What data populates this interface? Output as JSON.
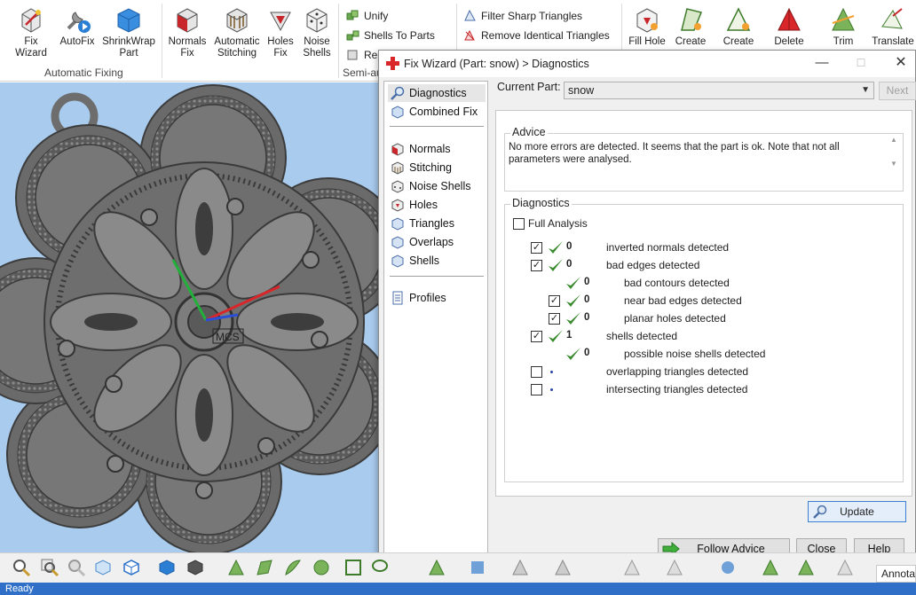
{
  "ribbon": {
    "buttons": [
      {
        "label": "Fix\nWizard",
        "icon": "fix-wizard-icon"
      },
      {
        "label": "AutoFix",
        "icon": "autofix-icon"
      },
      {
        "label": "ShrinkWrap\nPart",
        "icon": "shrinkwrap-icon"
      },
      {
        "label": "Normals\nFix",
        "icon": "normals-fix-icon"
      },
      {
        "label": "Automatic\nStitching",
        "icon": "stitching-icon"
      },
      {
        "label": "Holes\nFix",
        "icon": "holes-fix-icon"
      },
      {
        "label": "Noise\nShells",
        "icon": "noise-shells-icon"
      },
      {
        "label": "Fill Hole",
        "icon": "fill-hole-icon"
      },
      {
        "label": "Create",
        "icon": "create-icon"
      },
      {
        "label": "Create",
        "icon": "create-triangle-icon"
      },
      {
        "label": "Delete",
        "icon": "delete-icon"
      },
      {
        "label": "Trim",
        "icon": "trim-icon"
      },
      {
        "label": "Translate",
        "icon": "translate-icon"
      }
    ],
    "small_items": [
      {
        "label": "Unify",
        "icon": "unify-icon"
      },
      {
        "label": "Shells To Parts",
        "icon": "shells-to-parts-icon"
      },
      {
        "label": "Re",
        "icon": "re-icon"
      },
      {
        "label": "Filter Sharp Triangles",
        "icon": "filter-sharp-icon"
      },
      {
        "label": "Remove Identical Triangles",
        "icon": "remove-identical-icon"
      }
    ],
    "groups": {
      "automatic_fixing": "Automatic Fixing",
      "semi_auto": "Semi-au"
    }
  },
  "viewport": {
    "axis_label": "MCS"
  },
  "dialog": {
    "title": "Fix Wizard (Part: snow) > Diagnostics",
    "controls": {
      "minimize": "—",
      "maximize": "☐",
      "close": "✕"
    },
    "nav": [
      {
        "label": "Diagnostics",
        "icon": "diagnostics-icon",
        "selected": true
      },
      {
        "label": "Combined Fix",
        "icon": "combined-fix-icon"
      },
      {
        "label": "Normals",
        "icon": "normals-icon"
      },
      {
        "label": "Stitching",
        "icon": "stitching-icon"
      },
      {
        "label": "Noise Shells",
        "icon": "noise-shells-icon"
      },
      {
        "label": "Holes",
        "icon": "holes-icon"
      },
      {
        "label": "Triangles",
        "icon": "triangles-icon"
      },
      {
        "label": "Overlaps",
        "icon": "overlaps-icon"
      },
      {
        "label": "Shells",
        "icon": "shells-icon"
      },
      {
        "label": "Profiles",
        "icon": "profiles-icon"
      }
    ],
    "current_part_label": "Current Part:",
    "current_part_value": "snow",
    "next_label": "Next",
    "advice_title": "Advice",
    "advice_text": "No more errors are detected. It seems that the part is ok. Note that not all parameters were analysed.",
    "diagnostics_title": "Diagnostics",
    "full_analysis_label": "Full Analysis",
    "full_analysis_checked": false,
    "rows": [
      {
        "checked": true,
        "status": "ok",
        "count": "0",
        "label": "inverted normals detected",
        "indent": 0
      },
      {
        "checked": true,
        "status": "ok",
        "count": "0",
        "label": "bad edges detected",
        "indent": 0
      },
      {
        "checked": null,
        "status": "ok",
        "count": "0",
        "label": "bad contours detected",
        "indent": 1
      },
      {
        "checked": true,
        "status": "ok",
        "count": "0",
        "label": "near bad edges detected",
        "indent": 1
      },
      {
        "checked": true,
        "status": "ok",
        "count": "0",
        "label": "planar holes detected",
        "indent": 1
      },
      {
        "checked": true,
        "status": "ok",
        "count": "1",
        "label": "shells detected",
        "indent": 0
      },
      {
        "checked": null,
        "status": "ok",
        "count": "0",
        "label": "possible noise shells detected",
        "indent": 1
      },
      {
        "checked": false,
        "status": "none",
        "count": "",
        "label": "overlapping triangles detected",
        "indent": 0
      },
      {
        "checked": false,
        "status": "none",
        "count": "",
        "label": "intersecting triangles detected",
        "indent": 0
      }
    ],
    "update_label": "Update",
    "follow_advice_label": "Follow Advice",
    "close_label": "Close",
    "help_label": "Help"
  },
  "bottom": {
    "annotation_tab": "Annota"
  },
  "status": {
    "text": "Ready"
  },
  "colors": {
    "viewport_bg": "#a9cbee",
    "status_bar": "#2f6fc8",
    "check_green": "#3a8a2e",
    "accent_red": "#c8262a"
  }
}
